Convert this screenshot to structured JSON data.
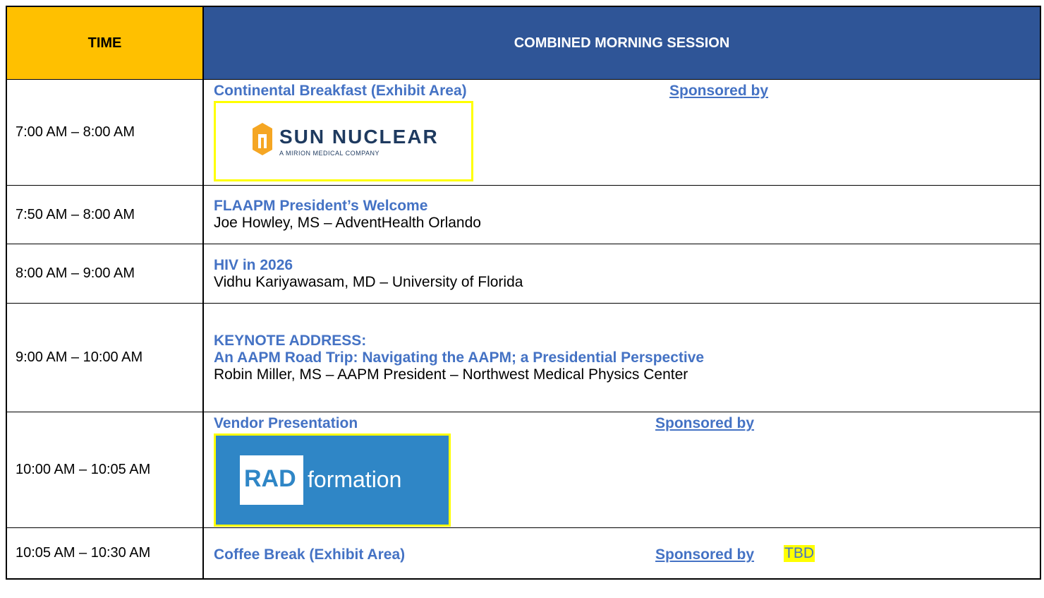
{
  "header": {
    "time_label": "TIME",
    "session_label": "COMBINED MORNING SESSION"
  },
  "rows": [
    {
      "time": "7:00 AM – 8:00 AM",
      "title": "Continental Breakfast (Exhibit Area)",
      "sponsored_label": "Sponsored by",
      "sponsor_logo": {
        "name": "SUN NUCLEAR",
        "tagline": "A MIRION MEDICAL COMPANY",
        "brand_color": "#1e3a5f",
        "accent": "#f5a623"
      }
    },
    {
      "time": "7:50 AM – 8:00 AM",
      "title": "FLAAPM President’s Welcome",
      "speaker": "Joe Howley, MS – AdventHealth Orlando"
    },
    {
      "time": "8:00 AM – 9:00 AM",
      "title": "HIV in 2026",
      "speaker": "Vidhu Kariyawasam, MD – University of Florida"
    },
    {
      "time": "9:00 AM – 10:00 AM",
      "title": "KEYNOTE ADDRESS:",
      "title2": "An AAPM Road Trip: Navigating the AAPM; a Presidential Perspective",
      "speaker": "Robin Miller, MS – AAPM President – Northwest Medical Physics Center"
    },
    {
      "time": "10:00 AM – 10:05 AM",
      "title": "Vendor Presentation",
      "sponsored_label": "Sponsored by",
      "sponsor_logo": {
        "part1": "RAD",
        "part2": "formation",
        "bg_color": "#2f86c6"
      }
    },
    {
      "time": "10:05 AM – 10:30 AM",
      "title": "Coffee Break (Exhibit Area)",
      "sponsored_label": "Sponsored by",
      "sponsor": "TBD"
    }
  ],
  "colors": {
    "header_time_bg": "#ffc000",
    "header_session_bg": "#2f5597",
    "title_text": "#4472c4",
    "highlight": "#ffff00"
  }
}
